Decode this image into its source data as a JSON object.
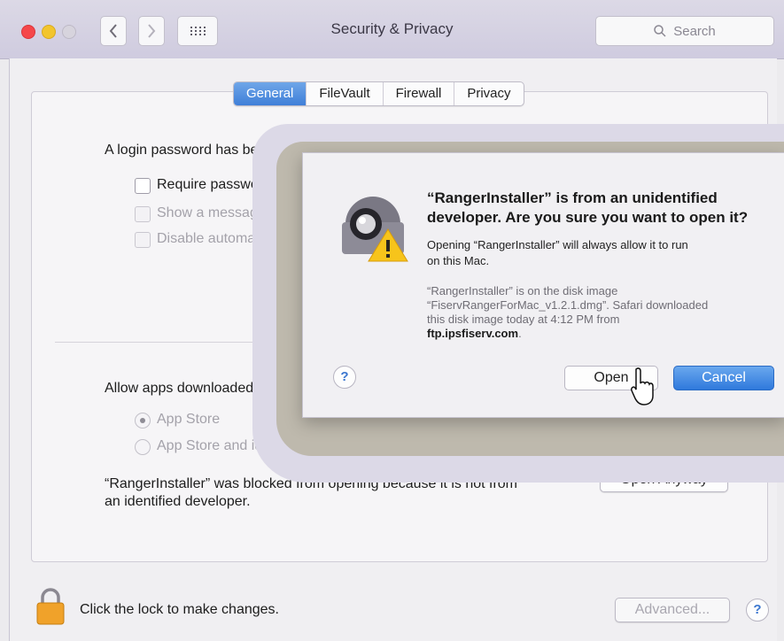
{
  "window": {
    "title": "Security & Privacy",
    "search_placeholder": "Search"
  },
  "tabs": [
    {
      "label": "General",
      "active": true
    },
    {
      "label": "FileVault",
      "active": false
    },
    {
      "label": "Firewall",
      "active": false
    },
    {
      "label": "Privacy",
      "active": false
    }
  ],
  "general": {
    "login_password_text": "A login password has been s",
    "require_password_label": "Require password",
    "show_message_label": "Show a message wh",
    "disable_auto_login_label": "Disable automatic lo",
    "allow_apps_label": "Allow apps downloaded from",
    "radio_app_store": "App Store",
    "radio_app_store_identified": "App Store and identified developers",
    "blocked_text_line1": "“RangerInstaller” was blocked from opening because it is not from",
    "blocked_text_line2": "an identified developer.",
    "open_anyway_label": "Open Anyway"
  },
  "footer": {
    "lock_text": "Click the lock to make changes.",
    "advanced_label": "Advanced...",
    "help_label": "?"
  },
  "dialog": {
    "title_line1": "“RangerInstaller” is from an unidentified",
    "title_line2": "developer. Are you sure you want to open it?",
    "message_line1": "Opening “RangerInstaller” will always allow it to run",
    "message_line2": "on this Mac.",
    "note_line1": "“RangerInstaller” is on the disk image",
    "note_line2": "“FiservRangerForMac_v1.2.1.dmg”. Safari downloaded",
    "note_line3": "this disk image today at 4:12 PM from",
    "note_source": "ftp.ipsfiserv.com",
    "note_period": ".",
    "help_label": "?",
    "open_label": "Open",
    "cancel_label": "Cancel"
  },
  "colors": {
    "accent": "#3f7fd8",
    "close": "#f5474a",
    "minimize": "#f2c52d",
    "lock": "#f0a22a"
  }
}
